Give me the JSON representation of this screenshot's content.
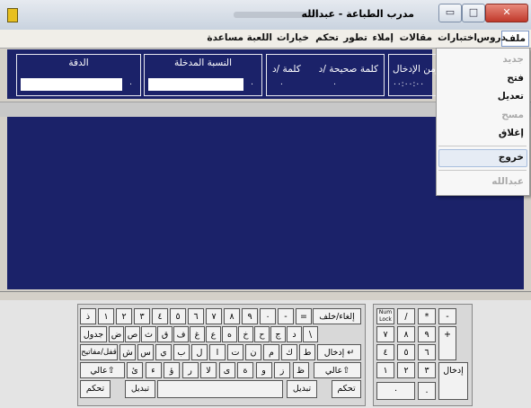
{
  "window": {
    "title": "مدرب الطباعة - عبدالله"
  },
  "menubar": {
    "items": [
      "ملف",
      "دروس",
      "اختبارات",
      "مقالات",
      "إملاء",
      "تطور",
      "تحكم",
      "خيارات",
      "اللعبة",
      "مساعدة"
    ]
  },
  "file_menu": {
    "items": [
      {
        "label": "جديد",
        "enabled": false
      },
      {
        "label": "فتح",
        "enabled": true
      },
      {
        "label": "تعديل",
        "enabled": true
      },
      {
        "label": "مسح",
        "enabled": false
      },
      {
        "label": "إغلاق",
        "enabled": true
      },
      {
        "label": "خروج",
        "enabled": true,
        "highlighted": true
      },
      {
        "label": "عبدالله",
        "enabled": false
      }
    ]
  },
  "status": {
    "time_label": "زمن الإدخال",
    "time_value": "٠٠:٠٠:٠٠",
    "wpm_label": "كلمة /د",
    "correct_label": "كلمة صحيحة /د",
    "wpm_value": "٠",
    "correct_value": "٠",
    "ratio_label": "النسبة المدخلة",
    "ratio_value": "٠",
    "accuracy_label": "الدقة",
    "accuracy_value": "٠"
  },
  "keyboard": {
    "row1": [
      "ذ",
      "١",
      "٢",
      "٣",
      "٤",
      "٥",
      "٦",
      "٧",
      "٨",
      "٩",
      "٠",
      "-",
      "="
    ],
    "row1_sub": [
      "ّ",
      "!",
      "@",
      "#",
      "$",
      "%",
      "^",
      "&",
      "*",
      ")",
      "(",
      "_",
      "+"
    ],
    "backspace": "إلغاء/خلف",
    "tab": "جدول",
    "row2": [
      "ض",
      "ص",
      "ث",
      "ق",
      "ف",
      "غ",
      "ع",
      "ه",
      "خ",
      "ح",
      "ج",
      "د",
      "\\"
    ],
    "caps": "قفل/مفاتيح",
    "row3": [
      "ش",
      "س",
      "ي",
      "ب",
      "ل",
      "ا",
      "ت",
      "ن",
      "م",
      "ك",
      "ط"
    ],
    "enter": "إدخال ↵",
    "shift_left": "عالي⇧",
    "row4": [
      "ئ",
      "ء",
      "ؤ",
      "ر",
      "لا",
      "ى",
      "ة",
      "و",
      "ز",
      "ظ"
    ],
    "shift_right": "عالي⇧",
    "ctrl": "تحكم",
    "alt": "تبديل",
    "numpad": {
      "numlock": "Num Lock",
      "keys": [
        "/",
        "*",
        "-",
        "٧",
        "٨",
        "٩",
        "+",
        "٤",
        "٥",
        "٦",
        "١",
        "٢",
        "٣",
        "٠",
        ".",
        "إدخال"
      ]
    }
  }
}
